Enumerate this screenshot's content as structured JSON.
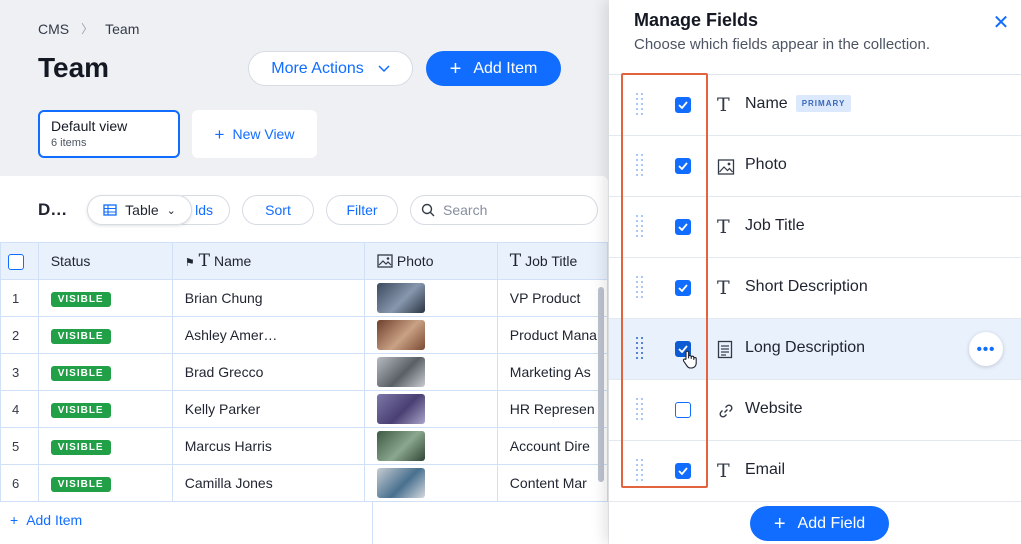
{
  "breadcrumb": {
    "root": "CMS",
    "current": "Team"
  },
  "page": {
    "title": "Team"
  },
  "actions": {
    "more_label": "More Actions",
    "add_item_label": "Add Item"
  },
  "views": {
    "default": {
      "label": "Default view",
      "count": "6 items"
    },
    "new_label": "New View"
  },
  "toolbar": {
    "title_truncated": "D…",
    "table_label": "Table",
    "fields_label": "lds",
    "sort_label": "Sort",
    "filter_label": "Filter",
    "search_placeholder": "Search"
  },
  "table": {
    "headers": {
      "status": "Status",
      "name": "Name",
      "photo": "Photo",
      "job_title": "Job Title"
    },
    "rows": [
      {
        "num": "1",
        "status": "VISIBLE",
        "name": "Brian Chung",
        "job": "VP Product"
      },
      {
        "num": "2",
        "status": "VISIBLE",
        "name": "Ashley Amer…",
        "job": "Product Mana"
      },
      {
        "num": "3",
        "status": "VISIBLE",
        "name": "Brad Grecco",
        "job": "Marketing As"
      },
      {
        "num": "4",
        "status": "VISIBLE",
        "name": "Kelly Parker",
        "job": "HR Represen"
      },
      {
        "num": "5",
        "status": "VISIBLE",
        "name": "Marcus Harris",
        "job": "Account Dire"
      },
      {
        "num": "6",
        "status": "VISIBLE",
        "name": "Camilla Jones",
        "job": "Content Mar"
      }
    ],
    "add_item_label": "Add Item"
  },
  "panel": {
    "title": "Manage Fields",
    "subtitle": "Choose which fields appear in the collection.",
    "primary_badge": "PRIMARY",
    "fields": [
      {
        "name": "Name",
        "checked": true,
        "type": "text"
      },
      {
        "name": "Photo",
        "checked": true,
        "type": "image"
      },
      {
        "name": "Job Title",
        "checked": true,
        "type": "text"
      },
      {
        "name": "Short Description",
        "checked": true,
        "type": "text"
      },
      {
        "name": "Long Description",
        "checked": true,
        "type": "rich-text"
      },
      {
        "name": "Website",
        "checked": false,
        "type": "url"
      },
      {
        "name": "Email",
        "checked": true,
        "type": "text"
      }
    ],
    "add_field_label": "Add Field"
  },
  "colors": {
    "accent": "#116dff",
    "visible_badge": "#21a047",
    "highlight_border": "#e2643f"
  }
}
